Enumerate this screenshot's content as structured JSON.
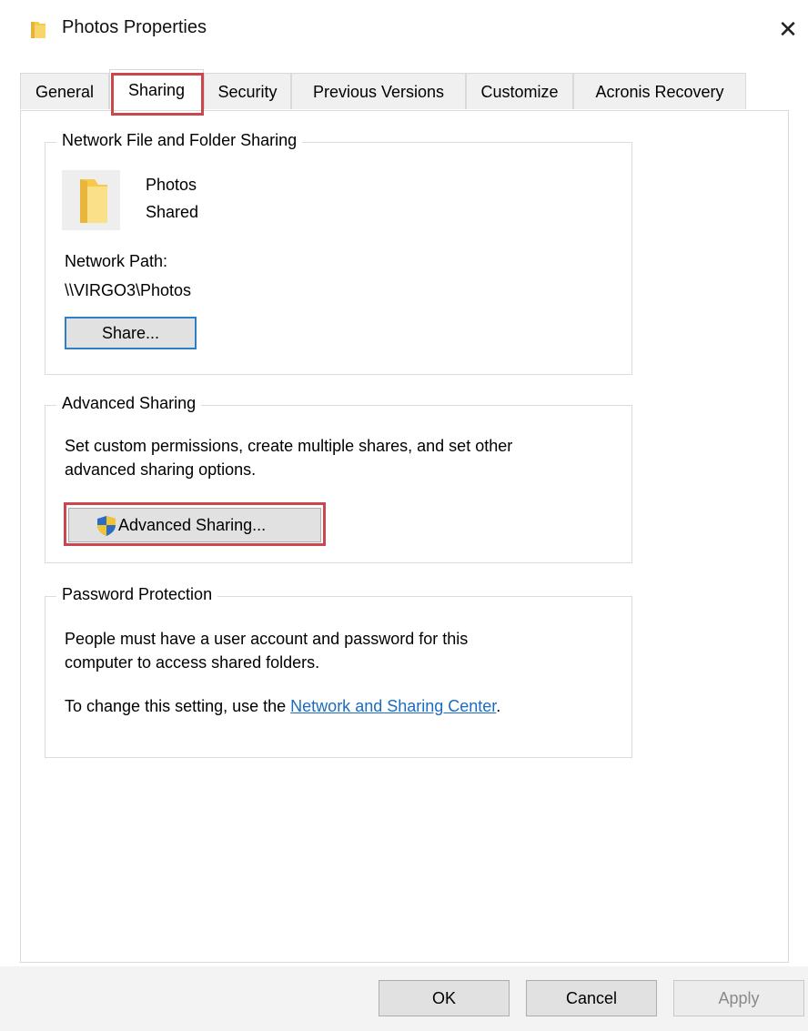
{
  "window": {
    "title": "Photos Properties",
    "close_glyph": "✕"
  },
  "tabs": [
    {
      "label": "General",
      "active": false
    },
    {
      "label": "Sharing",
      "active": true
    },
    {
      "label": "Security",
      "active": false
    },
    {
      "label": "Previous Versions",
      "active": false
    },
    {
      "label": "Customize",
      "active": false
    },
    {
      "label": "Acronis Recovery",
      "active": false
    }
  ],
  "network_sharing": {
    "legend": "Network File and Folder Sharing",
    "folder_name": "Photos",
    "folder_state": "Shared",
    "path_label": "Network Path:",
    "path_value": "\\\\VIRGO3\\Photos",
    "share_button": "Share..."
  },
  "advanced_sharing": {
    "legend": "Advanced Sharing",
    "description_line1": "Set custom permissions, create multiple shares, and set other",
    "description_line2": "advanced sharing options.",
    "button": "Advanced Sharing..."
  },
  "password_protection": {
    "legend": "Password Protection",
    "description_line1": "People must have a user account and password for this",
    "description_line2": "computer to access shared folders.",
    "change_prefix": "To change this setting, use the ",
    "change_link": "Network and Sharing Center",
    "change_suffix": "."
  },
  "buttons": {
    "ok": "OK",
    "cancel": "Cancel",
    "apply": "Apply"
  },
  "colors": {
    "highlight": "#c9474d",
    "link": "#1b6bc0",
    "focus_border": "#2d7fc8",
    "folder": "#f6c94b"
  },
  "icons": {
    "title": "folder-icon",
    "shared_folder": "folder-icon",
    "admin": "shield-icon",
    "close": "close-icon"
  }
}
